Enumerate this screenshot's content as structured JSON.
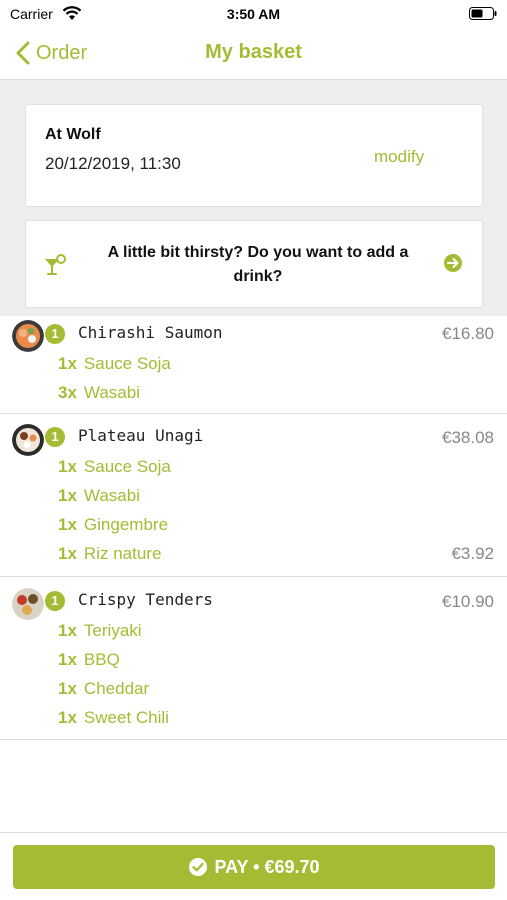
{
  "status_bar": {
    "carrier": "Carrier",
    "time": "3:50 AM"
  },
  "nav": {
    "back_label": "Order",
    "title": "My basket"
  },
  "restaurant": {
    "name": "At Wolf",
    "datetime": "20/12/2019, 11:30",
    "modify_label": "modify"
  },
  "drink_prompt": {
    "text": "A little bit thirsty? Do you want to add a drink?"
  },
  "items": [
    {
      "qty": "1",
      "name": "Chirashi Saumon",
      "price": "€16.80",
      "options": [
        {
          "qty": "1x",
          "name": "Sauce Soja",
          "price": ""
        },
        {
          "qty": "3x",
          "name": "Wasabi",
          "price": ""
        }
      ]
    },
    {
      "qty": "1",
      "name": "Plateau Unagi",
      "price": "€38.08",
      "options": [
        {
          "qty": "1x",
          "name": "Sauce Soja",
          "price": ""
        },
        {
          "qty": "1x",
          "name": "Wasabi",
          "price": ""
        },
        {
          "qty": "1x",
          "name": "Gingembre",
          "price": ""
        },
        {
          "qty": "1x",
          "name": "Riz nature",
          "price": "€3.92"
        }
      ]
    },
    {
      "qty": "1",
      "name": "Crispy Tenders",
      "price": "€10.90",
      "options": [
        {
          "qty": "1x",
          "name": "Teriyaki",
          "price": ""
        },
        {
          "qty": "1x",
          "name": "BBQ",
          "price": ""
        },
        {
          "qty": "1x",
          "name": "Cheddar",
          "price": ""
        },
        {
          "qty": "1x",
          "name": "Sweet Chili",
          "price": ""
        }
      ]
    }
  ],
  "pay_button": {
    "label": "PAY • €69.70"
  },
  "colors": {
    "accent": "#a5bb34",
    "price_grey": "#888888",
    "background_grey": "#eeeeee"
  },
  "icons": [
    "wifi-icon",
    "battery-icon",
    "chevron-left-icon",
    "cocktail-icon",
    "arrow-right-circle-icon",
    "food-thumbnail",
    "check-circle-icon"
  ]
}
